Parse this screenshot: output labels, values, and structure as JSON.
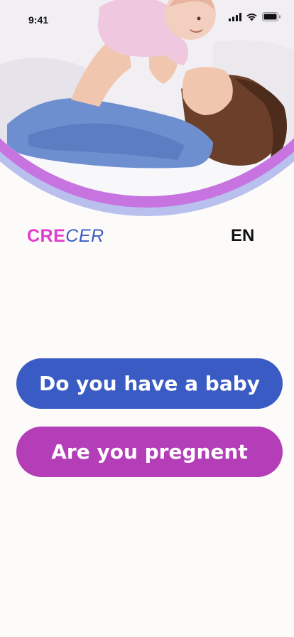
{
  "status_bar": {
    "time": "9:41",
    "icons": [
      "signal-icon",
      "wifi-icon",
      "battery-icon"
    ]
  },
  "hero": {
    "image": "mother-lifting-baby-photo",
    "ring_colors": [
      "#c774e0",
      "#b9c0ee"
    ]
  },
  "brand": {
    "part1": "CRE",
    "part2": "CER",
    "colors": {
      "part1": "#e03ccf",
      "part2": "#3a5bc4"
    }
  },
  "language": {
    "label": "EN"
  },
  "actions": {
    "baby_label": "Do you have a baby",
    "pregnant_label": "Are you pregnent",
    "colors": {
      "baby": "#3a5bc4",
      "pregnant": "#b43db8"
    }
  }
}
